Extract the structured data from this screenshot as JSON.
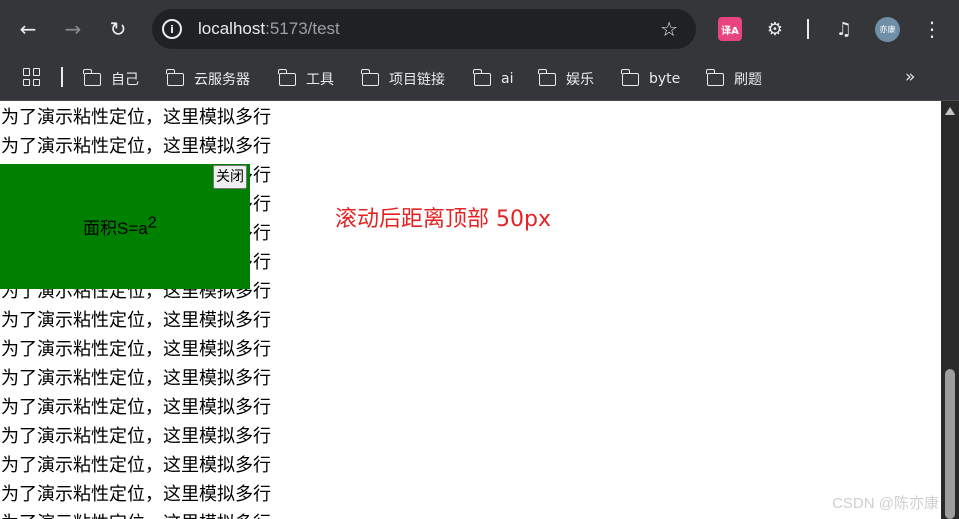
{
  "browser": {
    "back_icon": "back-arrow-icon",
    "forward_icon": "forward-arrow-icon",
    "reload_icon": "reload-icon",
    "url_host": "localhost",
    "url_rest": ":5173/test",
    "avatar_text": "亦康"
  },
  "bookmarks": [
    {
      "label": "自己"
    },
    {
      "label": "云服务器"
    },
    {
      "label": "工具"
    },
    {
      "label": "项目链接"
    },
    {
      "label": "ai"
    },
    {
      "label": "娱乐"
    },
    {
      "label": "byte"
    },
    {
      "label": "刷题"
    }
  ],
  "page": {
    "line_text": "为了演示粘性定位，这里模拟多行",
    "sticky": {
      "label": "面积S=a",
      "superscript": "2",
      "close_label": "关闭",
      "background": "#008000"
    },
    "note": "滚动后距离顶部 50px",
    "note_color": "#e52323",
    "watermark": "CSDN @陈亦康"
  }
}
